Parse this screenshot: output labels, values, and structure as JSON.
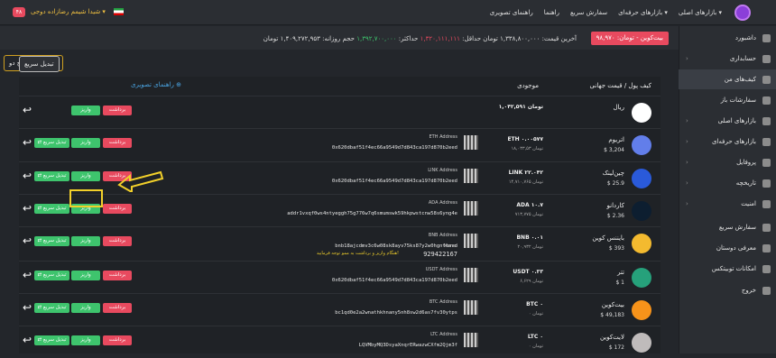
{
  "header": {
    "nav": [
      "بازارهای اصلی ▾",
      "بازارهای حرفه‌ای ▾",
      "سفارش سریع",
      "راهنما",
      "راهنمای تصویری"
    ],
    "user": "شیدا شیمم رضازاده دوجی ▾",
    "notif": "۴۸"
  },
  "ticker": {
    "price": "بیت‌کوین - تومان: ۹۸,۹۷۰",
    "last": "آخرین قیمت: ۱,۳۳۸,۸۰۰,۰۰۰ تومان",
    "min_label": "حداقل:",
    "min": "۱,۳۲۰,۱۱۱,۱۱۱",
    "max_label": "حداکثر:",
    "max": "۱,۳۹۲,۷۰۰,۰۰۰",
    "volume": "حجم روزانه: ۱,۴۰۹,۲۷۲,۹۵۳ تومان"
  },
  "verify_button": "تایید شده سطح دو",
  "quick_button": "تبدیل سریع",
  "sidebar": {
    "items": [
      {
        "label": "داشبورد",
        "caret": ""
      },
      {
        "label": "حسابداری",
        "caret": "›"
      },
      {
        "label": "کیف‌های من",
        "caret": ""
      },
      {
        "label": "سفارشات باز",
        "caret": ""
      },
      {
        "label": "بازارهای اصلی",
        "caret": "›"
      },
      {
        "label": "بازارهای حرفه‌ای",
        "caret": "›"
      },
      {
        "label": "پروفایل",
        "caret": "›"
      },
      {
        "label": "تاریخچه",
        "caret": "›"
      },
      {
        "label": "امنیت",
        "caret": "›"
      },
      {
        "label": "سفارش سریع",
        "caret": ""
      },
      {
        "label": "معرفی دوستان",
        "caret": ""
      },
      {
        "label": "امکانات توبیتکس",
        "caret": ""
      },
      {
        "label": "خروج",
        "caret": ""
      }
    ]
  },
  "table": {
    "col_name": "کیف پول / قیمت جهانی",
    "col_stock": "موجودی",
    "guide": "راهنمای تصویری ⊕",
    "withdraw": "برداشت",
    "deposit": "واریز",
    "convert": "⇄ تبدیل سریع",
    "rows": [
      {
        "name": "ریال",
        "price": "",
        "balance": "۱,۰۴۲,۵۹۱ تومان",
        "balance2": "",
        "addr_label": "",
        "addr": "",
        "color": "#ffffff"
      },
      {
        "name": "اتریوم",
        "price": "$ 3,204",
        "balance": "ETH ۰.۰۰۵۷۷",
        "balance2": "۱۸,۰۳۳,۵۳ تومان",
        "addr_label": "ETH Address",
        "addr": "0x620dbaf51f4ec66a9549d7d843ca197d870b2eed",
        "color": "#627eea"
      },
      {
        "name": "چین‌لینک",
        "price": "$ 25.9",
        "balance": "LINK ۲۲.۰۴۲",
        "balance2": "۱۴,۷۱۰,۷۶۵ تومان",
        "addr_label": "LINK Address",
        "addr": "0x620dbaf51f4ec66a9549d7d843ca197d870b2eed",
        "color": "#2a5ada"
      },
      {
        "name": "کاردانو",
        "price": "$ 2.36",
        "balance": "ADA ۱۰.۷",
        "balance2": "۷۱۳,۷۷۵ تومان",
        "addr_label": "ADA Address",
        "addr": "addr1vxqf0ws4ntyeggh75g776w7q6smumswk59hkpwstcnw58s6yng4e",
        "color": "#0d1e30"
      },
      {
        "name": "بایننس کوین",
        "price": "$ 393",
        "balance": "BNB ۰.۰۱",
        "balance2": "۲۰,۹۳۲ تومان",
        "addr_label": "BNB Address",
        "addr": "bnb18ajcdmv3c6w08sk8ayv75ks87y2w0hgntcavd",
        "memo_label": "Memo",
        "memo": "929422167",
        "note": "هنگام واریز و برداشت به ممو توجه فرمایید!",
        "color": "#f3ba2f"
      },
      {
        "name": "تتر",
        "price": "$ 1",
        "balance": "USDT ۰.۳۳",
        "balance2": "۶,۶۲۹ تومان",
        "addr_label": "USDT Address",
        "addr": "0x620dbaf51f4ec66a9549d7d843ca197d870b2eed",
        "color": "#26a17b"
      },
      {
        "name": "بیت‌کوین",
        "price": "$ 49,183",
        "balance": "BTC ۰",
        "balance2": "۰ تومان",
        "addr_label": "BTC Address",
        "addr": "bc1qd0e2a2wnathkhnany5nh8sw2d6as7fv30ytps",
        "color": "#f7931a"
      },
      {
        "name": "لایت‌کوین",
        "price": "$ 172",
        "balance": "LTC ۰",
        "balance2": "۰ تومان",
        "addr_label": "LTC Address",
        "addr": "LQVMbyMQ3DsyaXnqrERwazwCXfm2Qjm3f",
        "color": "#bfbbbb"
      }
    ]
  },
  "colors": {
    "accent": "#e84a5f",
    "green": "#3ec46d",
    "highlight": "#f2d02a"
  }
}
